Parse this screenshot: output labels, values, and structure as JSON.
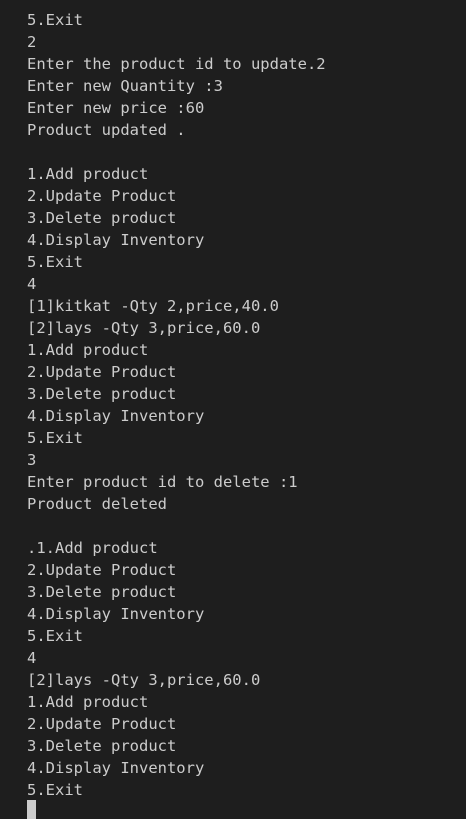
{
  "terminal": {
    "lines": [
      "5.Exit",
      "2",
      "Enter the product id to update.2",
      "Enter new Quantity :3",
      "Enter new price :60",
      "Product updated .",
      "",
      "1.Add product",
      "2.Update Product",
      "3.Delete product",
      "4.Display Inventory",
      "5.Exit",
      "4",
      "[1]kitkat -Qty 2,price,40.0",
      "[2]lays -Qty 3,price,60.0",
      "1.Add product",
      "2.Update Product",
      "3.Delete product",
      "4.Display Inventory",
      "5.Exit",
      "3",
      "Enter product id to delete :1",
      "Product deleted",
      "",
      ".1.Add product",
      "2.Update Product",
      "3.Delete product",
      "4.Display Inventory",
      "5.Exit",
      "4",
      "[2]lays -Qty 3,price,60.0",
      "1.Add product",
      "2.Update Product",
      "3.Delete product",
      "4.Display Inventory",
      "5.Exit"
    ]
  }
}
